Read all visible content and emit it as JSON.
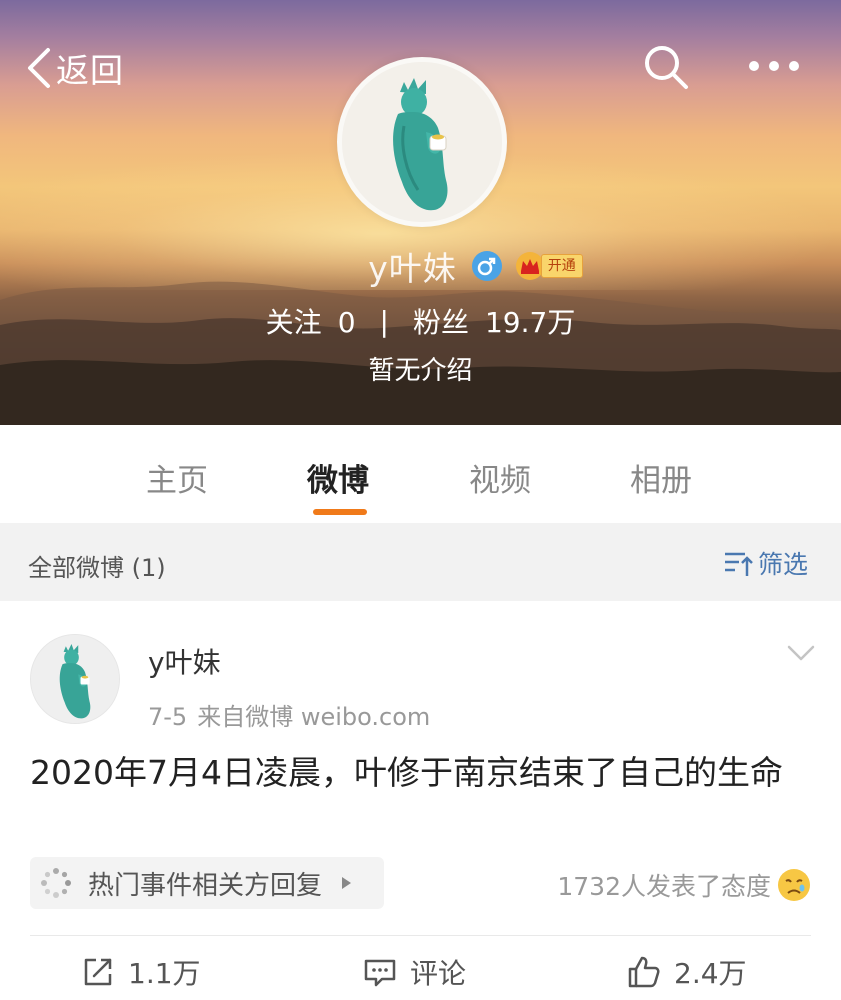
{
  "header": {
    "back_label": "返回",
    "username": "y叶妹",
    "vip_text": "开通",
    "following_label": "关注",
    "following_count": "0",
    "separator": "|",
    "followers_label": "粉丝",
    "followers_count": "19.7万",
    "bio": "暂无介绍"
  },
  "tabs": [
    {
      "label": "主页"
    },
    {
      "label": "微博"
    },
    {
      "label": "视频"
    },
    {
      "label": "相册"
    }
  ],
  "active_tab": "微博",
  "filter_bar": {
    "title": "全部微博 (1)",
    "filter_label": "筛选"
  },
  "post": {
    "username": "y叶妹",
    "date": "7-5",
    "source": "来自微博 weibo.com",
    "text": "2020年7月4日凌晨，叶修于南京结束了自己的生命",
    "topic_label": "热门事件相关方回复",
    "reactions_text": "1732人发表了态度",
    "actions": {
      "repost_count": "1.1万",
      "comment_label": "评论",
      "like_count": "2.4万"
    }
  },
  "colors": {
    "accent_orange": "#f07a1a",
    "filter_blue": "#4a78b0",
    "gender_blue": "#4aa3e6",
    "vip_gold": "#f9d56b"
  },
  "icons": [
    "back-chevron-icon",
    "search-icon",
    "more-icon",
    "male-gender-icon",
    "vip-crown-icon",
    "filter-icon",
    "dropdown-chevron-icon",
    "hot-topic-icon",
    "chip-arrow-icon",
    "sad-emoji-icon",
    "repost-icon",
    "comment-icon",
    "like-icon"
  ]
}
